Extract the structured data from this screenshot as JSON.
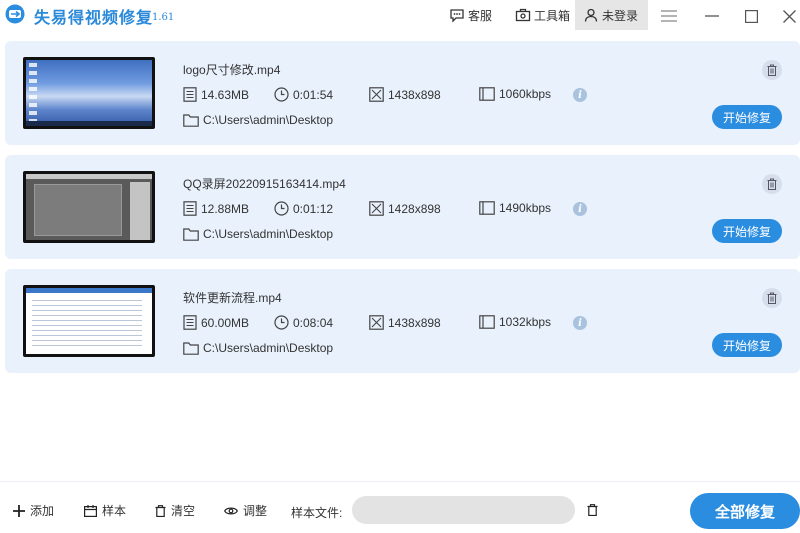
{
  "app": {
    "title": "失易得视频修复",
    "version": "1.61",
    "service_label": "客服",
    "toolbox_label": "工具箱",
    "login_label": "未登录",
    "accent_color": "#2b8de0"
  },
  "videos": [
    {
      "name": "logo尺寸修改.mp4",
      "size": "14.63MB",
      "duration": "0:01:54",
      "resolution": "1438x898",
      "bitrate": "1060kbps",
      "path": "C:\\Users\\admin\\Desktop",
      "action": "开始修复",
      "thumb_kind": "desktop-sky"
    },
    {
      "name": "QQ录屏20220915163414.mp4",
      "size": "12.88MB",
      "duration": "0:01:12",
      "resolution": "1428x898",
      "bitrate": "1490kbps",
      "path": "C:\\Users\\admin\\Desktop",
      "action": "开始修复",
      "thumb_kind": "gray-editor"
    },
    {
      "name": "软件更新流程.mp4",
      "size": "60.00MB",
      "duration": "0:08:04",
      "resolution": "1438x898",
      "bitrate": "1032kbps",
      "path": "C:\\Users\\admin\\Desktop",
      "action": "开始修复",
      "thumb_kind": "document"
    }
  ],
  "bottom": {
    "add_label": "添加",
    "sample_label": "样本",
    "clear_label": "清空",
    "adjust_label": "调整",
    "sample_file_label": "样本文件:",
    "sample_file_value": "",
    "fix_all_label": "全部修复"
  }
}
